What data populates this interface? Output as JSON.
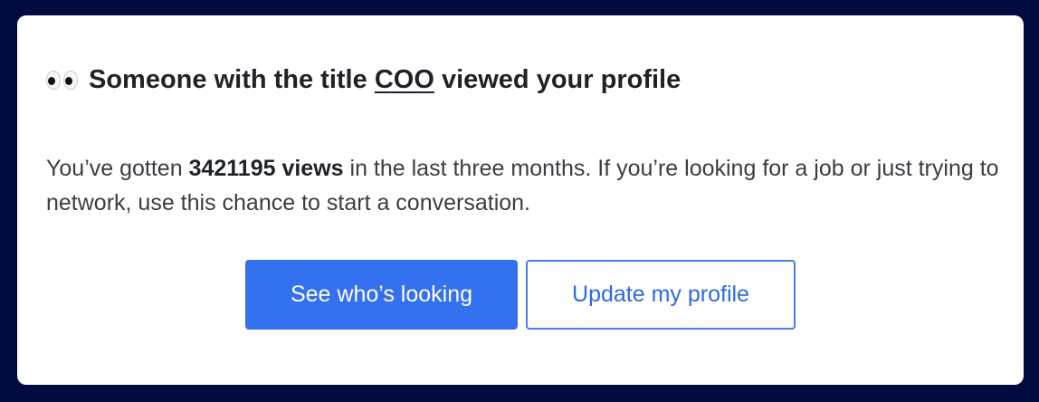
{
  "notification": {
    "icon": "eyes-icon",
    "heading_prefix": "Someone with the title",
    "heading_title": "COO",
    "heading_suffix": "viewed your profile",
    "body_prefix": "You’ve gotten",
    "views_count": "3421195 views",
    "body_suffix": "in the last three months. If you’re looking for a job or just trying to network, use this chance to start a conversation."
  },
  "actions": {
    "primary_label": "See who’s looking",
    "secondary_label": "Update my profile"
  },
  "colors": {
    "background": "#020b40",
    "card": "#ffffff",
    "primary_button": "#3371ef",
    "secondary_button_text": "#2f6ae0"
  }
}
